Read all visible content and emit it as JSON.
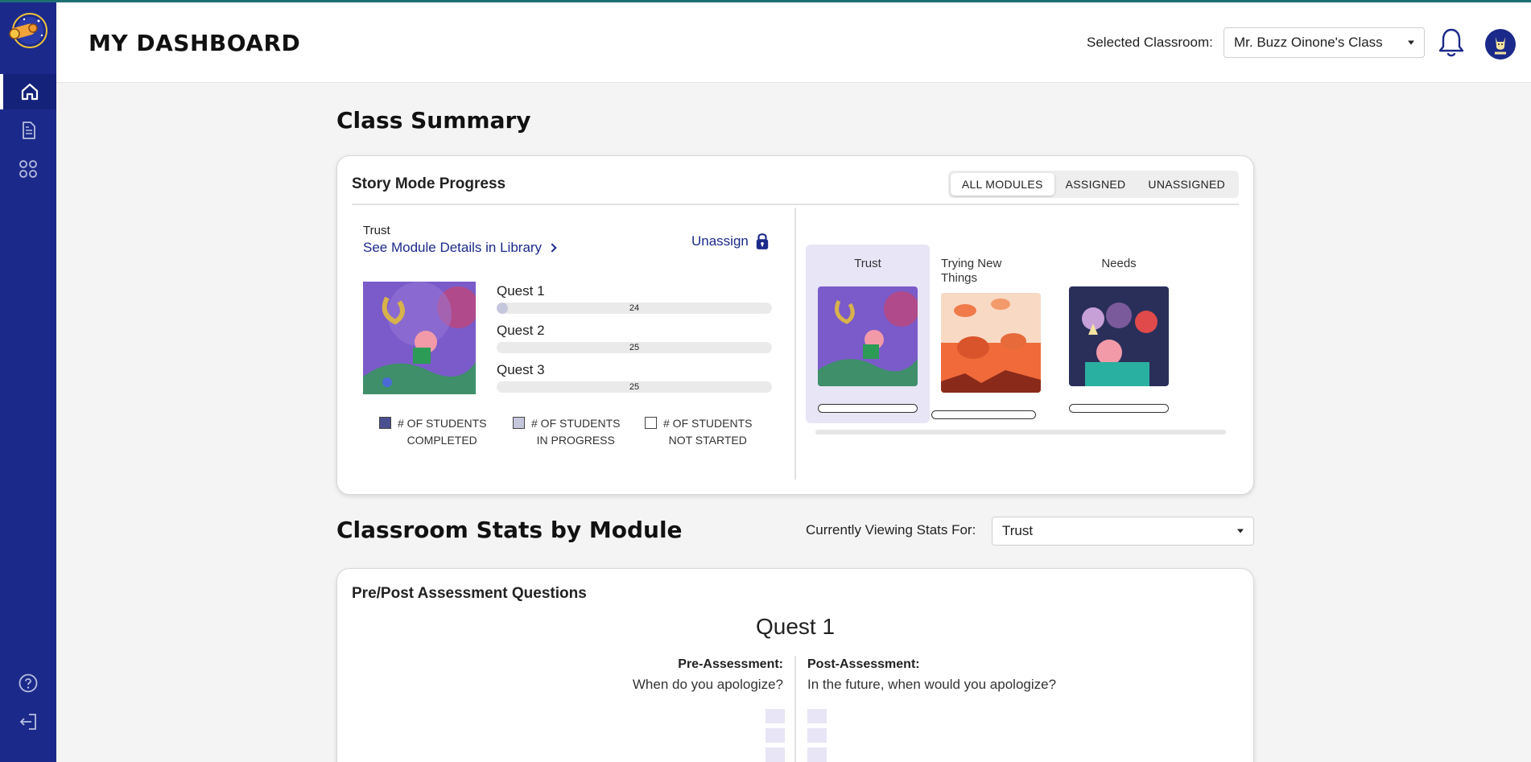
{
  "app": {
    "page_title": "MY DASHBOARD"
  },
  "sidebar": {
    "logo": "telescope-logo",
    "items": [
      {
        "name": "home",
        "icon": "home-icon",
        "active": true
      },
      {
        "name": "library",
        "icon": "document-icon",
        "active": false
      },
      {
        "name": "modules",
        "icon": "grid-icon",
        "active": false
      }
    ],
    "bottom": [
      {
        "name": "help",
        "icon": "help-icon"
      },
      {
        "name": "logout",
        "icon": "logout-icon"
      }
    ]
  },
  "header": {
    "classroom_label": "Selected Classroom:",
    "classroom_value": "Mr. Buzz Oinone's Class"
  },
  "class_summary": {
    "title": "Class Summary",
    "card_title": "Story Mode Progress",
    "tabs": [
      "ALL MODULES",
      "ASSIGNED",
      "UNASSIGNED"
    ],
    "active_tab": "ALL MODULES",
    "module_name": "Trust",
    "module_link": "See Module Details in Library",
    "unassign_label": "Unassign",
    "quests": [
      {
        "label": "Quest 1",
        "count": "24",
        "in_progress_fraction": 0.04
      },
      {
        "label": "Quest 2",
        "count": "25",
        "in_progress_fraction": 0
      },
      {
        "label": "Quest 3",
        "count": "25",
        "in_progress_fraction": 0
      }
    ],
    "legend": [
      {
        "text_1": "# OF STUDENTS",
        "text_2": "COMPLETED",
        "color": "#4a4f8f"
      },
      {
        "text_1": "# OF STUDENTS",
        "text_2": "IN PROGRESS",
        "color": "#c5c7dd"
      },
      {
        "text_1": "# OF STUDENTS",
        "text_2": "NOT STARTED",
        "color": "#ffffff"
      }
    ],
    "modules": [
      {
        "title": "Trust",
        "active": true
      },
      {
        "title": "Trying New Things",
        "active": false
      },
      {
        "title": "Needs",
        "active": false
      }
    ]
  },
  "stats": {
    "title": "Classroom Stats by Module",
    "viewing_label": "Currently Viewing Stats For:",
    "viewing_value": "Trust",
    "card_title": "Pre/Post Assessment Questions",
    "quest_title": "Quest 1",
    "pre_label": "Pre-Assessment:",
    "pre_question": "When do you apologize?",
    "post_label": "Post-Assessment:",
    "post_question": "In the future, when would you apologize?"
  },
  "colors": {
    "sidebar": "#1b2a8a",
    "link": "#1b2a8a",
    "tile_active": "#e8e5f6",
    "accent_line": "#1d6f74"
  }
}
